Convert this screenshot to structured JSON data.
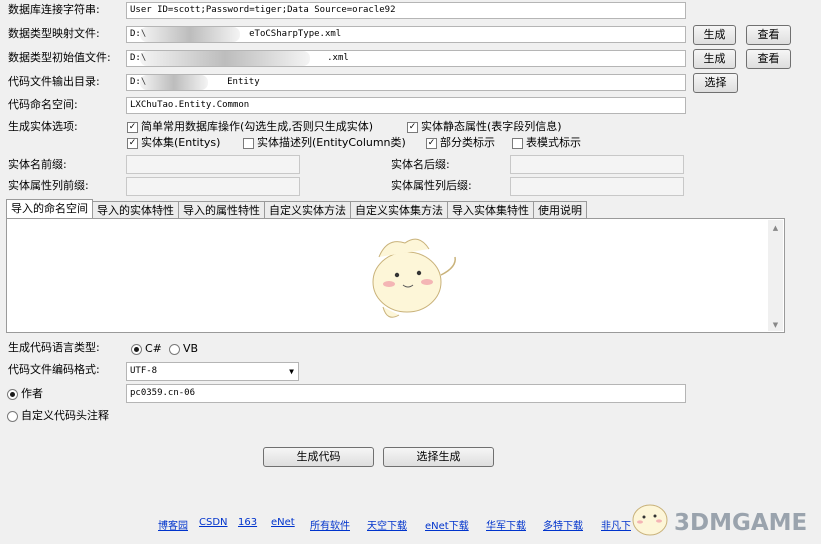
{
  "rows": {
    "conn": {
      "label": "数据库连接字符串:",
      "value": "User ID=scott;Password=tiger;Data Source=oracle92"
    },
    "typemap": {
      "label": "数据类型映射文件:",
      "value_prefix": "D:\\",
      "value_suffix": "eToCSharpType.xml",
      "btn_generate": "生成",
      "btn_view": "查看"
    },
    "typeinit": {
      "label": "数据类型初始值文件:",
      "value_prefix": "D:\\",
      "value_suffix": ".xml",
      "btn_generate": "生成",
      "btn_view": "查看"
    },
    "outdir": {
      "label": "代码文件输出目录:",
      "value_prefix": "D:\\",
      "value_suffix": "Entity",
      "btn_select": "选择"
    },
    "namespace": {
      "label": "代码命名空间:",
      "value": "LXChuTao.Entity.Common"
    }
  },
  "options": {
    "label": "生成实体选项:",
    "items": [
      {
        "label": "简单常用数据库操作(勾选生成,否则只生成实体)",
        "checked": true
      },
      {
        "label": "实体静态属性(表字段列信息)",
        "checked": true
      },
      {
        "label": "实体集(Entitys)",
        "checked": true
      },
      {
        "label": "实体描述列(EntityColumn类)",
        "checked": false
      },
      {
        "label": "部分类标示",
        "checked": true
      },
      {
        "label": "表模式标示",
        "checked": false
      }
    ]
  },
  "fixes": {
    "entity_prefix": "实体名前缀:",
    "entity_suffix": "实体名后缀:",
    "prop_prefix": "实体属性列前缀:",
    "prop_suffix": "实体属性列后缀:"
  },
  "tabs": [
    "导入的命名空间",
    "导入的实体特性",
    "导入的属性特性",
    "自定义实体方法",
    "自定义实体集方法",
    "导入实体集特性",
    "使用说明"
  ],
  "language": {
    "label": "生成代码语言类型:",
    "options": [
      {
        "label": "C#",
        "selected": true
      },
      {
        "label": "VB",
        "selected": false
      }
    ]
  },
  "encoding": {
    "label": "代码文件编码格式:",
    "value": "UTF-8"
  },
  "author": {
    "label": "作者",
    "value": "pc0359.cn-06"
  },
  "custom_header": {
    "label": "自定义代码头注释"
  },
  "actions": {
    "generate": "生成代码",
    "select_generate": "选择生成"
  },
  "footer_links": [
    "博客园",
    "CSDN",
    "163",
    "eNet",
    "所有软件",
    "天空下载",
    "eNet下载",
    "华军下载",
    "多特下载",
    "非凡下"
  ],
  "watermark": "3DMGAME",
  "colors": {
    "link": "#0033cc",
    "watermark": "#9aa3ad"
  }
}
